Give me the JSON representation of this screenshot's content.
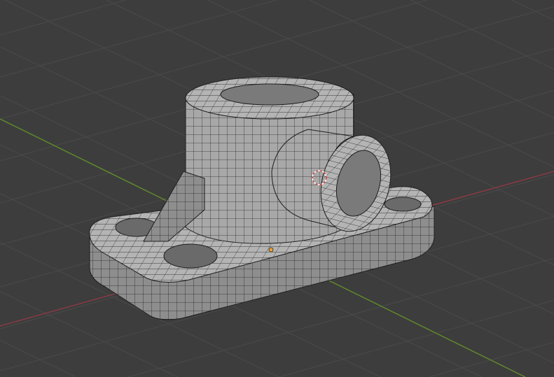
{
  "viewport": {
    "background_color": "#3d3d3d",
    "grid_color": "#4a4a4a",
    "x_axis_color": "#8a3a44",
    "y_axis_color": "#5e8a2a",
    "mesh_face_color": "#a9a9a9",
    "mesh_wire_color": "#1e1e1e",
    "origin_color": "#f0a030",
    "cursor_color": "#e04040"
  },
  "object": {
    "icon": "mesh-object",
    "selected": false
  }
}
